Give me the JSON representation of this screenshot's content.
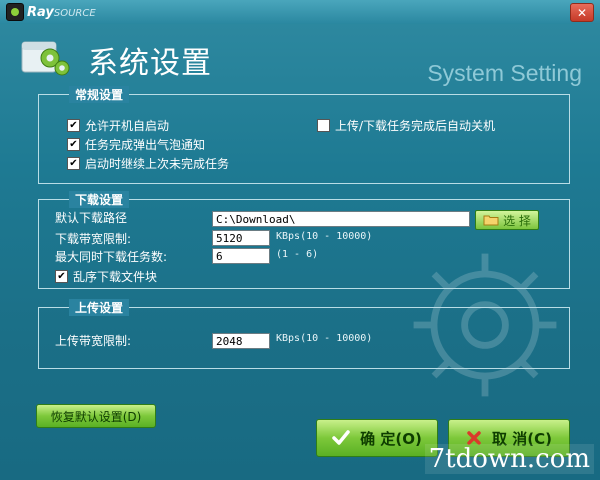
{
  "app": {
    "brand_main": "Ray",
    "brand_sub": "SOURCE",
    "close_glyph": "✕"
  },
  "header": {
    "title": "系统设置",
    "subtitle": "System Setting"
  },
  "general": {
    "legend": "常规设置",
    "autostart": {
      "label": "允许开机自启动",
      "checked": true
    },
    "bubble": {
      "label": "任务完成弹出气泡通知",
      "checked": true
    },
    "resume": {
      "label": "启动时继续上次未完成任务",
      "checked": true
    },
    "shutdown": {
      "label": "上传/下载任务完成后自动关机",
      "checked": false
    }
  },
  "download": {
    "legend": "下载设置",
    "path_label": "默认下载路径",
    "path_value": "C:\\Download\\",
    "select_label": "选 择",
    "bandwidth_label": "下载带宽限制:",
    "bandwidth_value": "5120",
    "bandwidth_hint": "KBps(10 - 10000)",
    "max_tasks_label": "最大同时下载任务数:",
    "max_tasks_value": "6",
    "max_tasks_hint": "(1 - 6)",
    "random_block": {
      "label": "乱序下载文件块",
      "checked": true
    }
  },
  "upload": {
    "legend": "上传设置",
    "bandwidth_label": "上传带宽限制:",
    "bandwidth_value": "2048",
    "bandwidth_hint": "KBps(10 - 10000)"
  },
  "buttons": {
    "restore": "恢复默认设置(D)",
    "ok": "确 定(O)",
    "cancel": "取 消(C)"
  },
  "watermark": "7tdown.com",
  "icons": {
    "logo": "raysource-logo-icon",
    "settings": "settings-gear-icon",
    "folder": "folder-icon",
    "check": "checkmark-icon",
    "cross": "cross-icon"
  },
  "colors": {
    "background": "#1e7a93",
    "button_green": "#7dc83a",
    "close_red": "#c53a28"
  }
}
